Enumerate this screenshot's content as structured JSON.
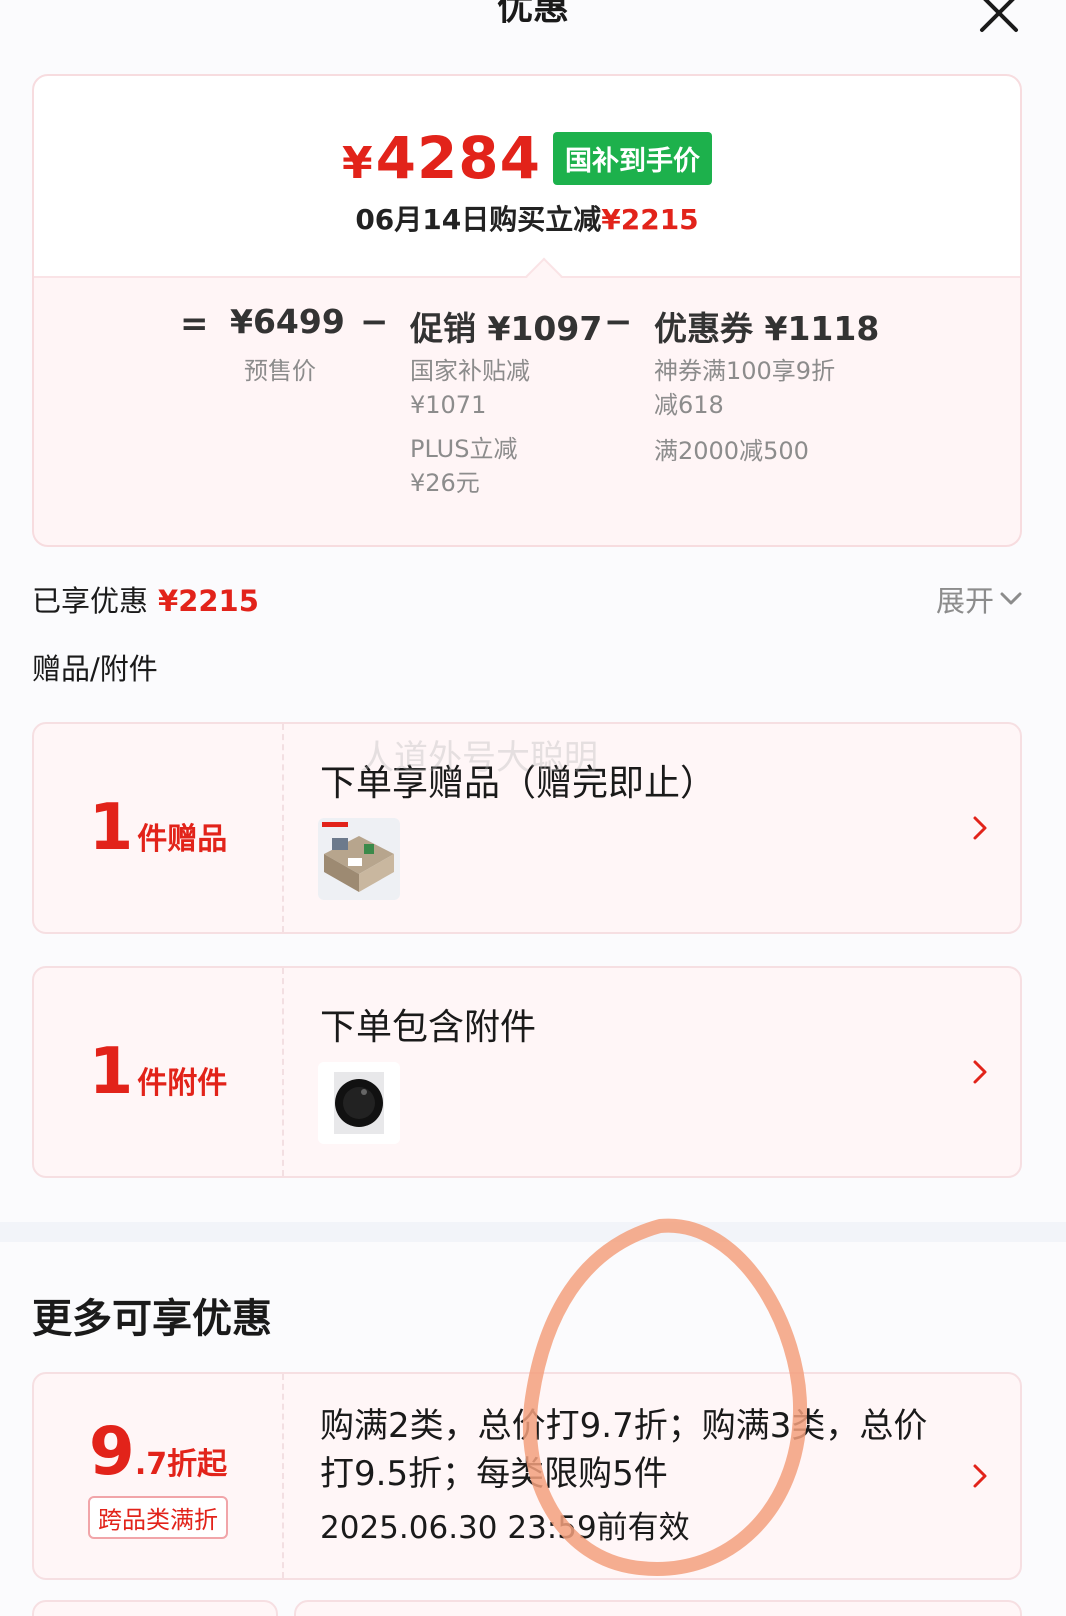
{
  "header": {
    "title": "优惠"
  },
  "price_card": {
    "final_price": "4284",
    "currency": "¥",
    "price_tag": "国补到手价",
    "subline_prefix": "06月14日购买立减",
    "subline_amount": "¥2215",
    "presale": {
      "value": "¥6499",
      "label": "预售价"
    },
    "promotion": {
      "value": "促销 ¥1097",
      "notes": [
        "国家补贴减",
        "¥1071",
        "PLUS立减",
        "¥26元"
      ]
    },
    "coupon": {
      "value": "优惠券 ¥1118",
      "notes": [
        "神券满100享9折",
        "减618",
        "满2000减500"
      ]
    },
    "ops": {
      "equals": "=",
      "minus": "−"
    }
  },
  "enjoyed": {
    "label": "已享优惠",
    "amount": "¥2215",
    "expand": "展开"
  },
  "gifts_section": {
    "label": "赠品/附件"
  },
  "gift_card": {
    "count": "1",
    "unit": "件赠品",
    "title": "下单享赠品（赠完即止）"
  },
  "accessory_card": {
    "count": "1",
    "unit": "件附件",
    "title": "下单包含附件"
  },
  "more": {
    "title": "更多可享优惠",
    "promo": {
      "big": "9",
      "small": ".7折起",
      "badge": "跨品类满折",
      "text": "购满2类，总价打9.7折；购满3类，总价打9.5折；每类限购5件",
      "valid": "2025.06.30 23:59前有效"
    }
  },
  "watermark": "人道外号大聪明",
  "colors": {
    "accent_red": "#e2231a",
    "tag_green": "#1db14c",
    "scribble": "#f3a07e"
  },
  "icons": [
    "close-icon",
    "chevron-down-icon",
    "chevron-right-icon"
  ]
}
